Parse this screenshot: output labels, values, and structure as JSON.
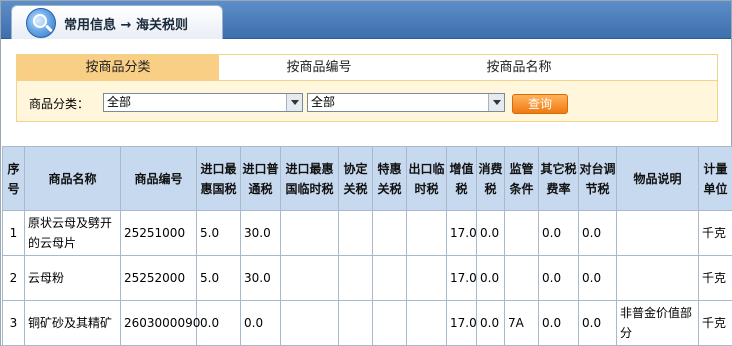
{
  "header": {
    "title": "常用信息 → 海关税则",
    "logo_icon": "magnifier-icon"
  },
  "tabs": [
    {
      "label": "按商品分类",
      "active": true
    },
    {
      "label": "按商品编号",
      "active": false
    },
    {
      "label": "按商品名称",
      "active": false
    }
  ],
  "filter": {
    "label": "商品分类：",
    "select1": "全部",
    "select2": "全部",
    "button": "查询"
  },
  "table": {
    "headers": [
      "序号",
      "商品名称",
      "商品编号",
      "进口最惠国税",
      "进口普通税",
      "进口最惠国临时税",
      "协定关税",
      "特惠关税",
      "出口临时税",
      "增值税",
      "消费税",
      "监管条件",
      "其它税费率",
      "对台调节税",
      "物品说明",
      "计量单位"
    ],
    "rows": [
      [
        "1",
        "原状云母及劈开的云母片",
        "25251000",
        "5.0",
        "30.0",
        "",
        "",
        "",
        "",
        "17.0",
        "0.0",
        "",
        "0.0",
        "0.0",
        "",
        "千克"
      ],
      [
        "2",
        "云母粉",
        "25252000",
        "5.0",
        "30.0",
        "",
        "",
        "",
        "",
        "17.0",
        "0.0",
        "",
        "0.0",
        "0.0",
        "",
        "千克"
      ],
      [
        "3",
        "铜矿砂及其精矿",
        "2603000090",
        "0.0",
        "0.0",
        "",
        "",
        "",
        "",
        "17.0",
        "0.0",
        "7A",
        "0.0",
        "0.0",
        "非普金价值部分",
        "千克"
      ]
    ]
  },
  "colors": {
    "header_blue": "#4a7cbc",
    "tab_active": "#f9cf85",
    "panel_bg": "#fff6dc",
    "table_header": "#c7d9ee",
    "button": "#f08a20"
  }
}
